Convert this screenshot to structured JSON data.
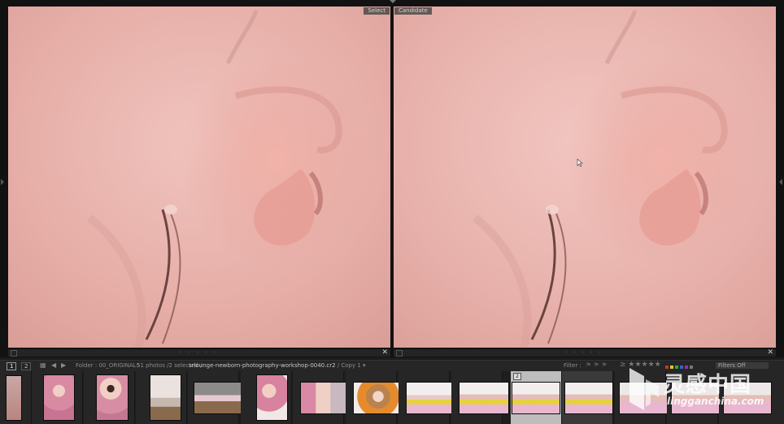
{
  "compare": {
    "select_label": "Select",
    "candidate_label": "Candidate"
  },
  "filmstrip_bar": {
    "view_buttons": [
      "1",
      "2"
    ],
    "folder": "Folder : 00_ORIGINALS",
    "photo_count": "51 photos /2 selected /",
    "filename": "srlounge-newborn-photography-workshop-0040.cr2",
    "copy": "/ Copy 1",
    "filter_label": "Filter :",
    "filters_state": "Filters Off"
  },
  "filmstrip": {
    "active_badge": "2"
  },
  "watermark": {
    "cn": "灵感中国",
    "en": "lingganchina.com"
  },
  "colors": {
    "skin": "#e8b3ad",
    "panel": "#262626",
    "active_cell": "#bdbdbd"
  }
}
